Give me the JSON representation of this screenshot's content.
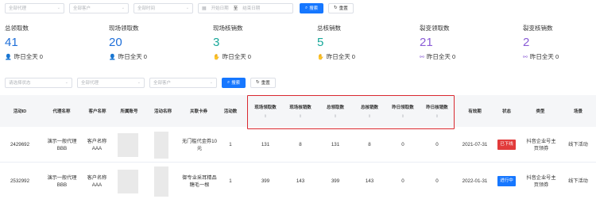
{
  "filters1": {
    "select1": "全部代理",
    "select2": "全部客户",
    "select3": "全部时间",
    "date_start": "开始日期",
    "date_sep": "至",
    "date_end": "结束日期",
    "search": "搜索",
    "reset": "重置"
  },
  "stats": [
    {
      "label": "总领取数",
      "value": "41",
      "yesterday": "昨日全天 0",
      "color": "#1f6fd9"
    },
    {
      "label": "现场领取数",
      "value": "20",
      "yesterday": "昨日全天 0",
      "color": "#1f6fd9"
    },
    {
      "label": "现场核销数",
      "value": "3",
      "yesterday": "昨日全天 0",
      "color": "#18a89a"
    },
    {
      "label": "总核销数",
      "value": "5",
      "yesterday": "昨日全天 0",
      "color": "#18a89a"
    },
    {
      "label": "裂变领取数",
      "value": "21",
      "yesterday": "昨日全天 0",
      "color": "#8a5cd6"
    },
    {
      "label": "裂变核销数",
      "value": "2",
      "yesterday": "昨日全天 0",
      "color": "#8a5cd6"
    }
  ],
  "filters2": {
    "select1": "请选择状态",
    "select2": "全部代理",
    "select3": "全部客户",
    "search": "搜索",
    "reset": "重置"
  },
  "columns": [
    {
      "label": "活动ID",
      "sortable": false
    },
    {
      "label": "代理名称",
      "sortable": false
    },
    {
      "label": "客户名称",
      "sortable": false
    },
    {
      "label": "所属账号",
      "sortable": false
    },
    {
      "label": "活动名称",
      "sortable": false
    },
    {
      "label": "关联卡券",
      "sortable": false
    },
    {
      "label": "活动数",
      "sortable": false
    },
    {
      "label": "现场领取数",
      "sortable": true
    },
    {
      "label": "现场核销数",
      "sortable": true
    },
    {
      "label": "总领取数",
      "sortable": true
    },
    {
      "label": "总核销数",
      "sortable": true
    },
    {
      "label": "昨日领取数",
      "sortable": true
    },
    {
      "label": "昨日核销数",
      "sortable": true
    },
    {
      "label": "有效期",
      "sortable": false
    },
    {
      "label": "状态",
      "sortable": false
    },
    {
      "label": "类型",
      "sortable": false
    },
    {
      "label": "场景",
      "sortable": false
    }
  ],
  "rows": [
    {
      "id": "2429692",
      "agent": "演示一般代理BBB",
      "customer": "客户名称AAA",
      "coupon": "无门槛代金券10元",
      "count": "1",
      "onsite_claim": "131",
      "onsite_verify": "8",
      "total_claim": "131",
      "total_verify": "8",
      "yest_claim": "0",
      "yest_verify": "0",
      "expiry": "2021-07-31",
      "status": "已下线",
      "status_color": "#e23b3b",
      "type": "抖音企业号主页领券",
      "scene": "线下活动"
    },
    {
      "id": "2532992",
      "agent": "演示一般代理BBB",
      "customer": "客户名称AAA",
      "coupon": "御专业采耳精品糖毛一根",
      "count": "1",
      "onsite_claim": "399",
      "onsite_verify": "143",
      "total_claim": "399",
      "total_verify": "143",
      "yest_claim": "0",
      "yest_verify": "0",
      "expiry": "2022-01-31",
      "status": "进行中",
      "status_color": "#1677ff",
      "type": "抖音企业号主页领券",
      "scene": "线下活动"
    }
  ]
}
